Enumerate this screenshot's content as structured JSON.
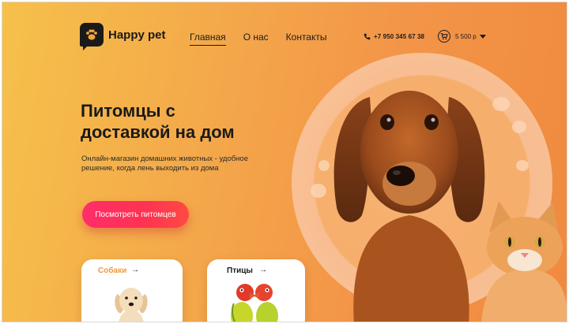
{
  "header": {
    "logo_text": "Happy pet",
    "nav": [
      {
        "label": "Главная",
        "active": true
      },
      {
        "label": "О нас",
        "active": false
      },
      {
        "label": "Контакты",
        "active": false
      }
    ],
    "phone": "+7 950 345 67 38",
    "cart_total": "5 500 р"
  },
  "hero": {
    "title_line1": "Питомцы с",
    "title_line2": "доставкой на дом",
    "subtitle": "Онлайн-магазин домашних животных - удобное решение, когда лень выходить из дома",
    "cta_label": "Посмотреть питомцев"
  },
  "categories": [
    {
      "label": "Собаки",
      "arrow": "→"
    },
    {
      "label": "Птицы",
      "arrow": "→"
    }
  ],
  "colors": {
    "bg_start": "#f6c04a",
    "bg_end": "#f08a3e",
    "cta": "#ff2d6a",
    "dogs_label": "#f29838"
  },
  "icons": [
    "paw-logo-icon",
    "phone-icon",
    "cart-icon",
    "caret-down-icon",
    "arrow-right-icon"
  ]
}
